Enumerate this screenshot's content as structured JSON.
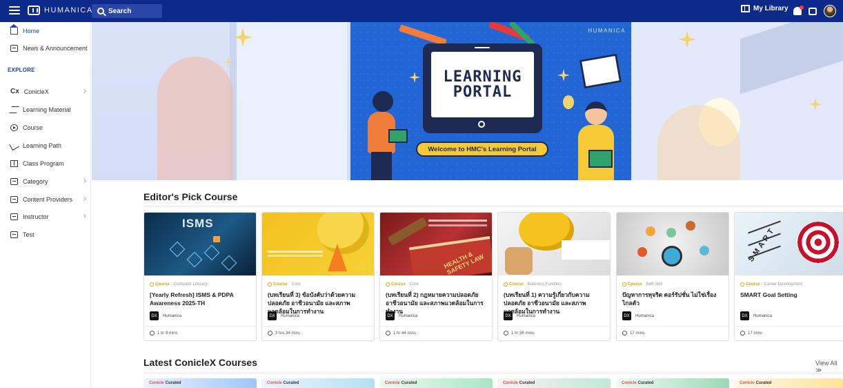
{
  "topbar": {
    "brand": "HUMANICA",
    "search_placeholder": "Search",
    "my_library": "My Library"
  },
  "sidebar": {
    "items": [
      {
        "label": "Home",
        "icon": "home-icon",
        "active": true
      },
      {
        "label": "News & Announcement",
        "icon": "news-icon"
      }
    ],
    "explore_label": "EXPLORE",
    "explore_items": [
      {
        "label": "ConicleX",
        "icon": "conicle-icon",
        "chevron": true
      },
      {
        "label": "Learning Material",
        "icon": "layers-icon"
      },
      {
        "label": "Course",
        "icon": "play-circle-icon"
      },
      {
        "label": "Learning Path",
        "icon": "path-icon"
      },
      {
        "label": "Class Program",
        "icon": "book-icon"
      },
      {
        "label": "Category",
        "icon": "category-icon",
        "chevron": true
      },
      {
        "label": "Content Providers",
        "icon": "folder-icon",
        "chevron": true
      },
      {
        "label": "Instructor",
        "icon": "instructor-icon",
        "chevron": true
      },
      {
        "label": "Test",
        "icon": "test-icon"
      }
    ]
  },
  "banner": {
    "brand": "HUMANICA",
    "line1": "LEARNING",
    "line2": "PORTAL",
    "welcome": "Welcome to HMC's Learning Portal"
  },
  "editors_pick": {
    "title": "Editor's Pick Course",
    "cards": [
      {
        "type": "Course",
        "category": "Computer Literacy",
        "title": "[Yearly Refresh] ISMS & PDPA Awareness 2025-TH",
        "provider": "Humanica",
        "duration": "1 hr 8 mins",
        "thumb_text": "ISMS"
      },
      {
        "type": "Course",
        "category": "Core",
        "title": "(บทเรียนที่ 3) ข้อบังคับว่าด้วยความปลอดภัย อาชีวอนามัย และสภาพแวดล้อมในการทำงาน",
        "provider": "Humanica",
        "duration": "3 hrs 34 mins"
      },
      {
        "type": "Course",
        "category": "Core",
        "title": "(บทเรียนที่ 2) กฎหมายความปลอดภัย อาชีวอนามัย และสภาพแวดล้อมในการทำงาน",
        "provider": "Humanica",
        "duration": "1 hr 44 mins",
        "thumb_text": "HEALTH & SAFETY LAW"
      },
      {
        "type": "Course",
        "category": "Business Function",
        "title": "(บทเรียนที่ 1) ความรู้เกี่ยวกับความปลอดภัย อาชีวอนามัย และสภาพแวดล้อมในการทำงาน",
        "provider": "Humanica",
        "duration": "1 hr 28 mins"
      },
      {
        "type": "Course",
        "category": "Soft Skill",
        "title": "ปัญหาการทุจริต คอร์รัปชั่น ไม่ใช่เรื่องไกลตัว",
        "provider": "Humanica",
        "duration": "17 mins"
      },
      {
        "type": "Course",
        "category": "Career Development",
        "title": "SMART Goal Setting",
        "provider": "Humanica",
        "duration": "17 mins",
        "thumb_text": "SMART"
      }
    ]
  },
  "latest": {
    "title": "Latest ConicleX Courses",
    "view_all": "View All",
    "card_brand": "Conicle",
    "card_suffix": "Curated"
  },
  "colors": {
    "topbar": "#0d2a8a",
    "accent": "#1b3fbf",
    "course_type": "#e6a400"
  }
}
